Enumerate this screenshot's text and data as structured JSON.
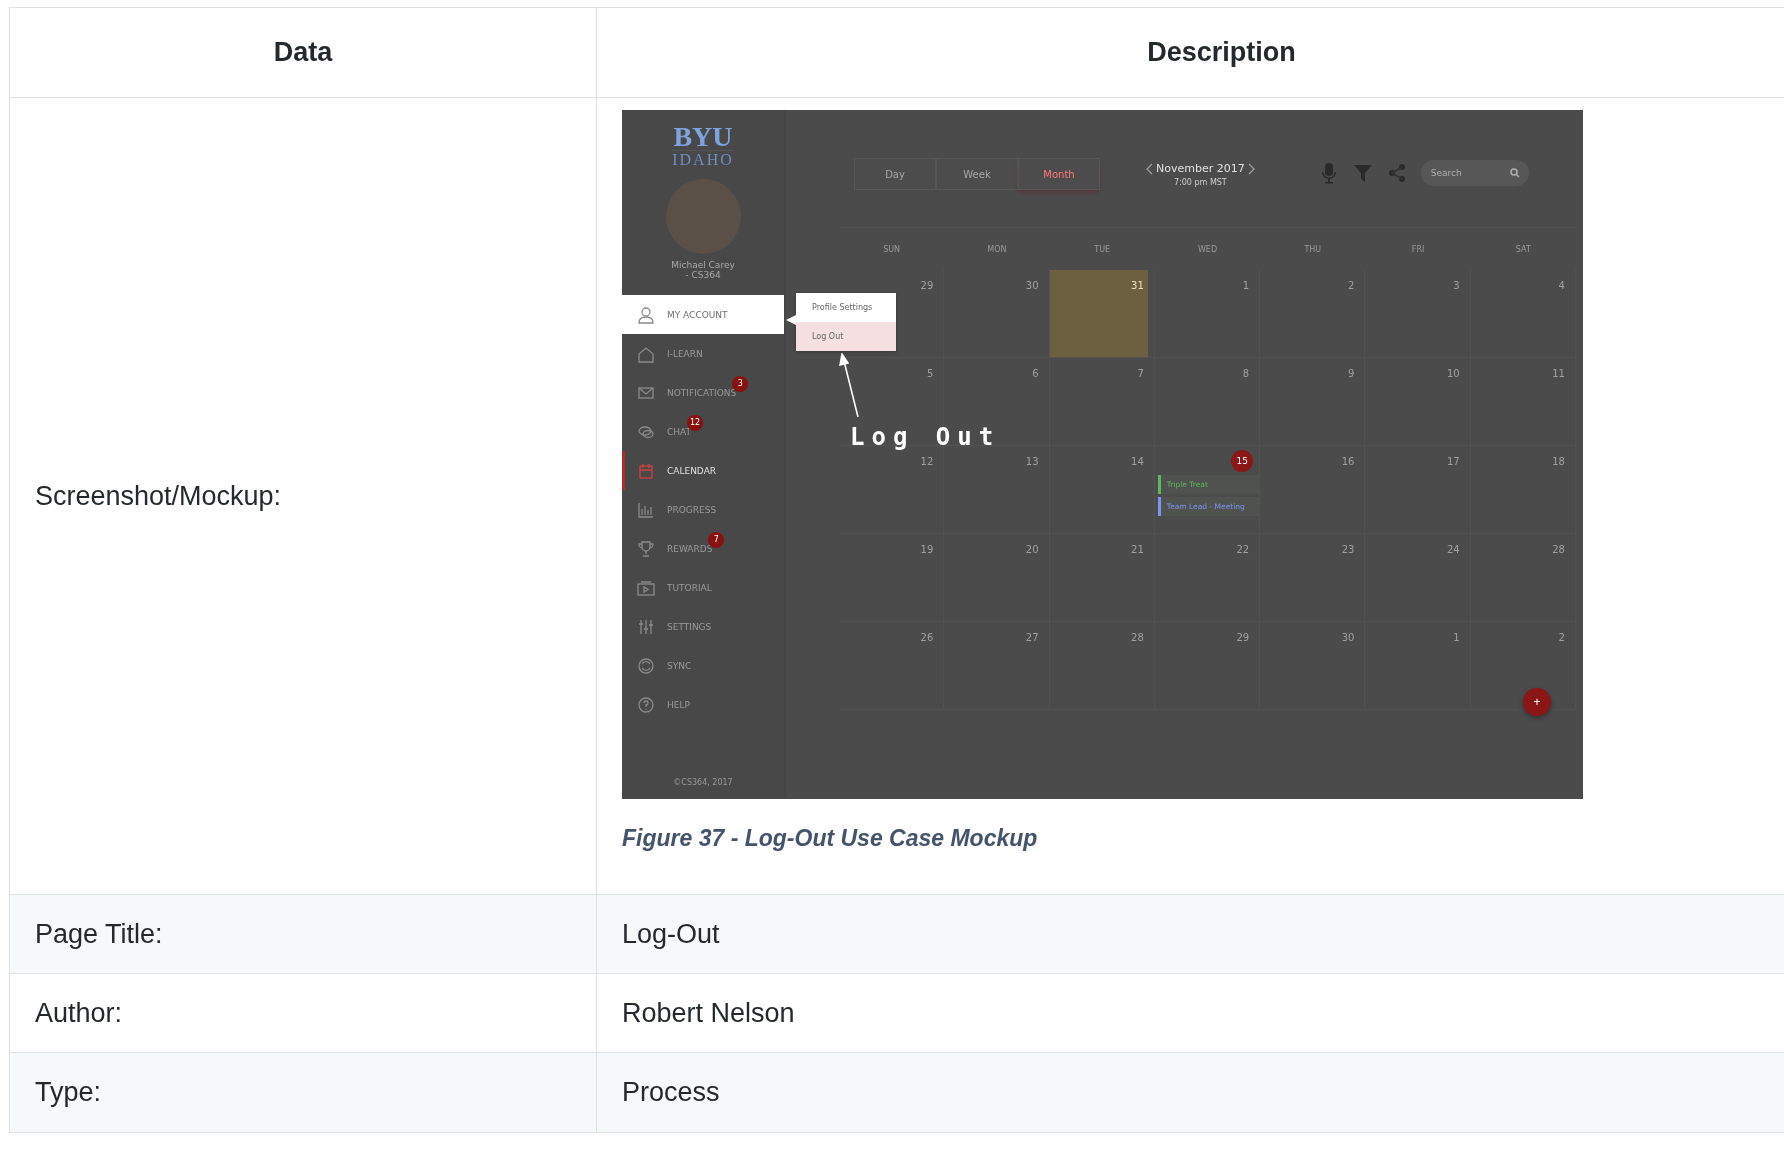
{
  "table": {
    "columns": [
      "Data",
      "Description"
    ],
    "rows": [
      {
        "kind": "mockup",
        "label": "Screenshot/Mockup:",
        "caption": "Figure 37 - Log-Out Use Case Mockup",
        "mockup": {
          "logo": {
            "top": "BYU",
            "bottom": "IDAHO"
          },
          "user_name_lines": [
            "Michael Carey",
            "- CS364"
          ],
          "nav": [
            {
              "label": "MY ACCOUNT",
              "expanded": true,
              "selected": false
            },
            {
              "label": "I-LEARN",
              "expanded": false,
              "selected": false
            },
            {
              "label": "NOTIFICATIONS",
              "badge": "3",
              "expanded": false,
              "selected": false
            },
            {
              "label": "CHAT",
              "badge": "12",
              "expanded": false,
              "selected": false
            },
            {
              "label": "CALENDAR",
              "expanded": false,
              "selected": true
            },
            {
              "label": "PROGRESS",
              "expanded": false,
              "selected": false
            },
            {
              "label": "REWARDS",
              "badge": "7",
              "expanded": false,
              "selected": false
            },
            {
              "label": "TUTORIAL",
              "expanded": false,
              "selected": false
            },
            {
              "label": "SETTINGS",
              "expanded": false,
              "selected": false
            },
            {
              "label": "SYNC",
              "expanded": false,
              "selected": false
            },
            {
              "label": "HELP",
              "expanded": false,
              "selected": false
            }
          ],
          "footer": "©CS364, 2017",
          "popup_menu": [
            {
              "label": "Profile Settings",
              "selected": false
            },
            {
              "label": "Log Out",
              "selected": true
            }
          ],
          "annotation": "Log Out",
          "view_tabs": [
            {
              "label": "Day",
              "selected": false
            },
            {
              "label": "Week",
              "selected": false
            },
            {
              "label": "Month",
              "selected": true
            }
          ],
          "month_title": "November 2017",
          "time": "7:00 pm MST",
          "search": {
            "placeholder": "Search"
          },
          "weekdays": [
            "SUN",
            "MON",
            "TUE",
            "WED",
            "THU",
            "FRI",
            "SAT"
          ],
          "weeks": [
            [
              {
                "day": "29",
                "kind": "plain"
              },
              {
                "day": "30",
                "kind": "plain"
              },
              {
                "day": "31",
                "kind": "image"
              },
              {
                "day": "1",
                "kind": "plain"
              },
              {
                "day": "2",
                "kind": "plain"
              },
              {
                "day": "3",
                "kind": "plain"
              },
              {
                "day": "4",
                "kind": "plain"
              }
            ],
            [
              {
                "day": "5",
                "kind": "plain"
              },
              {
                "day": "6",
                "kind": "plain"
              },
              {
                "day": "7",
                "kind": "plain"
              },
              {
                "day": "8",
                "kind": "plain"
              },
              {
                "day": "9",
                "kind": "plain"
              },
              {
                "day": "10",
                "kind": "plain"
              },
              {
                "day": "11",
                "kind": "plain"
              }
            ],
            [
              {
                "day": "12",
                "kind": "plain"
              },
              {
                "day": "13",
                "kind": "plain"
              },
              {
                "day": "14",
                "kind": "plain"
              },
              {
                "day": "15",
                "kind": "today",
                "events": [
                  {
                    "title": "Triple Treat",
                    "color": "#5cb85c"
                  },
                  {
                    "title": "Team Lead - Meeting",
                    "color": "#7b96ee"
                  }
                ]
              },
              {
                "day": "16",
                "kind": "plain"
              },
              {
                "day": "17",
                "kind": "plain"
              },
              {
                "day": "18",
                "kind": "plain"
              }
            ],
            [
              {
                "day": "19",
                "kind": "plain"
              },
              {
                "day": "20",
                "kind": "plain"
              },
              {
                "day": "21",
                "kind": "plain"
              },
              {
                "day": "22",
                "kind": "plain"
              },
              {
                "day": "23",
                "kind": "plain"
              },
              {
                "day": "24",
                "kind": "plain"
              },
              {
                "day": "28",
                "kind": "plain"
              }
            ],
            [
              {
                "day": "26",
                "kind": "plain"
              },
              {
                "day": "27",
                "kind": "plain"
              },
              {
                "day": "28",
                "kind": "plain"
              },
              {
                "day": "29",
                "kind": "plain"
              },
              {
                "day": "30",
                "kind": "plain"
              },
              {
                "day": "1",
                "kind": "plain"
              },
              {
                "day": "2",
                "kind": "plain"
              }
            ]
          ],
          "add_button": "+"
        }
      },
      {
        "kind": "text",
        "label": "Page Title:",
        "value": "Log-Out"
      },
      {
        "kind": "text",
        "label": "Author:",
        "value": "Robert Nelson"
      },
      {
        "kind": "text",
        "label": "Type:",
        "value": "Process"
      }
    ]
  }
}
